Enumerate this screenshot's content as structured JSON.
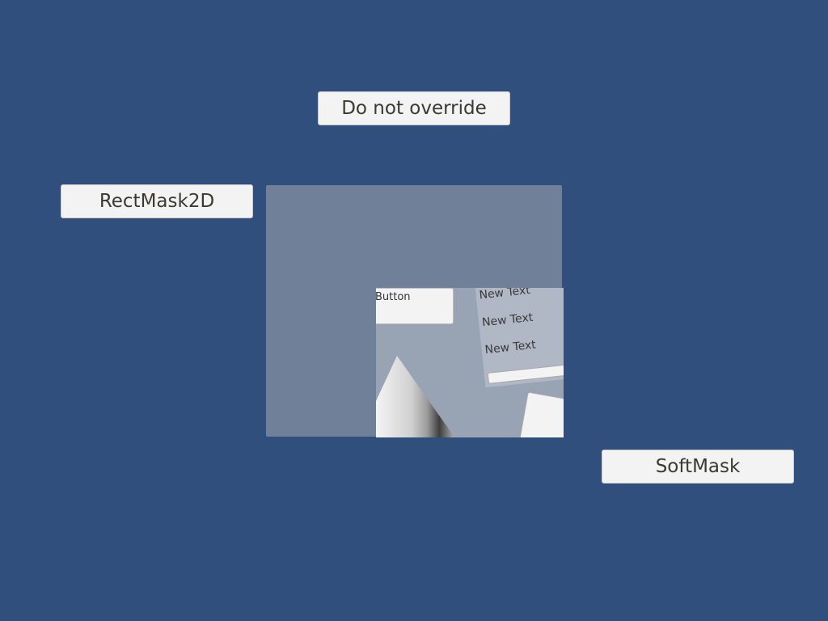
{
  "buttons": {
    "do_not_override": "Do not override",
    "rectmask2d": "RectMask2D",
    "softmask": "SoftMask"
  },
  "masked_content": {
    "button_label": "Button",
    "texts": [
      "New Text",
      "New Text",
      "New Text"
    ]
  },
  "colors": {
    "background": "#314f7c",
    "panel": "#708099",
    "button": "#f3f3f3",
    "button_text": "#3a3a33"
  }
}
